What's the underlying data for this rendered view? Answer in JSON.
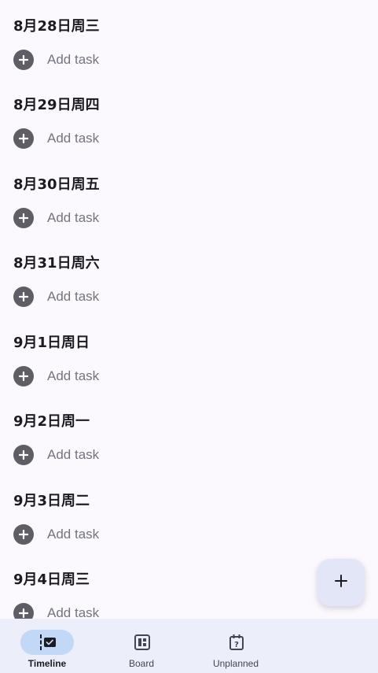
{
  "timeline": {
    "add_task_label": "Add task",
    "days": [
      {
        "title": "8月28日周三"
      },
      {
        "title": "8月29日周四"
      },
      {
        "title": "8月30日周五"
      },
      {
        "title": "8月31日周六"
      },
      {
        "title": "9月1日周日"
      },
      {
        "title": "9月2日周一"
      },
      {
        "title": "9月3日周二"
      },
      {
        "title": "9月4日周三"
      }
    ]
  },
  "fab": {
    "icon": "plus-icon"
  },
  "bottom_nav": {
    "items": [
      {
        "label": "Timeline",
        "icon": "timeline-icon",
        "active": true
      },
      {
        "label": "Board",
        "icon": "board-icon",
        "active": false
      },
      {
        "label": "Unplanned",
        "icon": "unplanned-icon",
        "active": false
      }
    ]
  },
  "colors": {
    "background": "#fcf9fe",
    "add_icon_bg": "#5f5e66",
    "nav_bg": "#eceef9",
    "nav_active_pill": "#c2d8f7",
    "fab_bg": "#e3e6f7"
  }
}
